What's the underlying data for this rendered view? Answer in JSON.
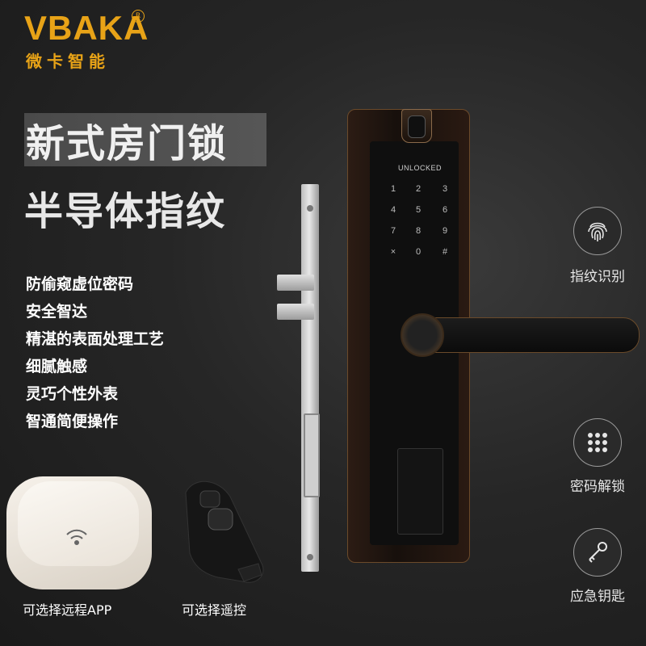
{
  "brand": {
    "name": "VBAKA",
    "reg_mark": "R",
    "subtitle": "微卡智能"
  },
  "headline": {
    "line1": "新式房门锁",
    "line2": "半导体指纹"
  },
  "features": [
    "防偷窥虚位密码",
    "安全智达",
    "精湛的表面处理工艺",
    "细腻触感",
    "灵巧个性外表",
    "智通简便操作"
  ],
  "lock": {
    "screen_status": "UNLOCKED",
    "keys": [
      "1",
      "2",
      "3",
      "4",
      "5",
      "6",
      "7",
      "8",
      "9",
      "×",
      "0",
      "#"
    ]
  },
  "unlock_methods": [
    {
      "label": "指纹识别",
      "icon": "fingerprint-icon"
    },
    {
      "label": "密码解锁",
      "icon": "keypad-icon"
    },
    {
      "label": "应急钥匙",
      "icon": "key-icon"
    }
  ],
  "accessories": [
    {
      "label": "可选择远程APP"
    },
    {
      "label": "可选择遥控"
    }
  ],
  "colors": {
    "brand": "#e8a317",
    "background": "#262626",
    "lock_trim": "#6b4a2a"
  }
}
